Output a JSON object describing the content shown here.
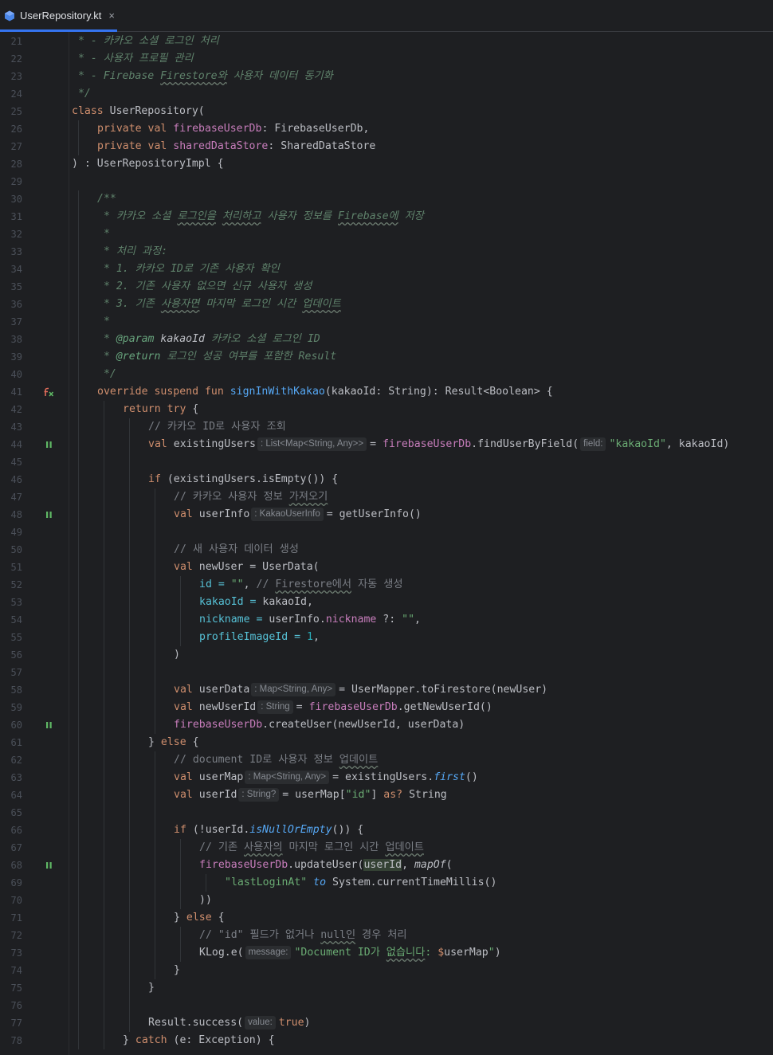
{
  "tab": {
    "filename": "UserRepository.kt",
    "close_label": "×"
  },
  "lines": [
    {
      "n": "21",
      "i": 0,
      "t": [
        [
          "doc",
          " * - 카카오 소셜 로그인 처리"
        ]
      ]
    },
    {
      "n": "22",
      "i": 0,
      "t": [
        [
          "doc",
          " * - 사용자 프로필 관리"
        ]
      ]
    },
    {
      "n": "23",
      "i": 0,
      "t": [
        [
          "doc",
          " * - Firebase "
        ],
        [
          "doc sq",
          "Firestore와"
        ],
        [
          "doc",
          " 사용자 데이터 동기화"
        ]
      ]
    },
    {
      "n": "24",
      "i": 0,
      "t": [
        [
          "doc",
          " */"
        ]
      ]
    },
    {
      "n": "25",
      "i": 0,
      "t": [
        [
          "kw",
          "class "
        ],
        [
          "",
          "UserRepository("
        ]
      ]
    },
    {
      "n": "26",
      "i": 1,
      "t": [
        [
          "kw",
          "private val "
        ],
        [
          "fld",
          "firebaseUserDb"
        ],
        [
          "",
          ": FirebaseUserDb,"
        ]
      ]
    },
    {
      "n": "27",
      "i": 1,
      "t": [
        [
          "kw",
          "private val "
        ],
        [
          "fld",
          "sharedDataStore"
        ],
        [
          "",
          ": SharedDataStore"
        ]
      ]
    },
    {
      "n": "28",
      "i": 0,
      "t": [
        [
          "",
          ") : UserRepositoryImpl {"
        ]
      ]
    },
    {
      "n": "29",
      "i": 0,
      "t": []
    },
    {
      "n": "30",
      "i": 1,
      "t": [
        [
          "doc",
          "/**"
        ]
      ]
    },
    {
      "n": "31",
      "i": 1,
      "t": [
        [
          "doc",
          " * 카카오 소셜 "
        ],
        [
          "doc sq",
          "로그인을"
        ],
        [
          "doc",
          " "
        ],
        [
          "doc sq",
          "처리하고"
        ],
        [
          "doc",
          " 사용자 정보를 "
        ],
        [
          "doc sq",
          "Firebase에"
        ],
        [
          "doc",
          " 저장"
        ]
      ]
    },
    {
      "n": "32",
      "i": 1,
      "t": [
        [
          "doc",
          " *"
        ]
      ]
    },
    {
      "n": "33",
      "i": 1,
      "t": [
        [
          "doc",
          " * 처리 과정:"
        ]
      ]
    },
    {
      "n": "34",
      "i": 1,
      "t": [
        [
          "doc",
          " * 1. 카카오 ID로 기존 사용자 확인"
        ]
      ]
    },
    {
      "n": "35",
      "i": 1,
      "t": [
        [
          "doc",
          " * 2. 기존 사용자 없으면 신규 사용자 생성"
        ]
      ]
    },
    {
      "n": "36",
      "i": 1,
      "t": [
        [
          "doc",
          " * 3. 기존 "
        ],
        [
          "doc sq",
          "사용자면"
        ],
        [
          "doc",
          " 마지막 로그인 시간 "
        ],
        [
          "doc sq",
          "업데이트"
        ]
      ]
    },
    {
      "n": "37",
      "i": 1,
      "t": [
        [
          "doc",
          " *"
        ]
      ]
    },
    {
      "n": "38",
      "i": 1,
      "t": [
        [
          "doc",
          " * "
        ],
        [
          "tag",
          "@param"
        ],
        [
          "it",
          " kakaoId"
        ],
        [
          "doc",
          " 카카오 소셜 로그인 ID"
        ]
      ]
    },
    {
      "n": "39",
      "i": 1,
      "t": [
        [
          "doc",
          " * "
        ],
        [
          "tag",
          "@return"
        ],
        [
          "doc",
          " 로그인 성공 여부를 포함한 Result"
        ]
      ]
    },
    {
      "n": "40",
      "i": 1,
      "t": [
        [
          "doc",
          " */"
        ]
      ]
    },
    {
      "n": "41",
      "i": 1,
      "g": "fx",
      "t": [
        [
          "kw",
          "override suspend fun "
        ],
        [
          "fn",
          "signInWithKakao"
        ],
        [
          "",
          "(kakaoId: String): Result<Boolean> {"
        ]
      ]
    },
    {
      "n": "42",
      "i": 2,
      "t": [
        [
          "kw",
          "return try "
        ],
        [
          "",
          "{"
        ]
      ]
    },
    {
      "n": "43",
      "i": 3,
      "t": [
        [
          "cm",
          "// 카카오 ID로 사용자 조회"
        ]
      ]
    },
    {
      "n": "44",
      "i": 3,
      "g": "susp",
      "t": [
        [
          "kw",
          "val "
        ],
        [
          "",
          "existingUsers"
        ],
        [
          "hint",
          ": List<Map<String, Any>>"
        ],
        [
          "",
          "= "
        ],
        [
          "fld",
          "firebaseUserDb"
        ],
        [
          "",
          ".findUserByField("
        ],
        [
          "hint",
          "field:"
        ],
        [
          "str",
          "\"kakaoId\""
        ],
        [
          "",
          ", kakaoId)"
        ]
      ]
    },
    {
      "n": "45",
      "i": 3,
      "t": []
    },
    {
      "n": "46",
      "i": 3,
      "t": [
        [
          "kw",
          "if "
        ],
        [
          "",
          "(existingUsers.isEmpty()) {"
        ]
      ]
    },
    {
      "n": "47",
      "i": 4,
      "t": [
        [
          "cm",
          "// 카카오 사용자 정보 "
        ],
        [
          "cm sq",
          "가져오기"
        ]
      ]
    },
    {
      "n": "48",
      "i": 4,
      "g": "susp",
      "t": [
        [
          "kw",
          "val "
        ],
        [
          "",
          "userInfo"
        ],
        [
          "hint",
          ": KakaoUserInfo"
        ],
        [
          "",
          "= getUserInfo()"
        ]
      ]
    },
    {
      "n": "49",
      "i": 4,
      "t": []
    },
    {
      "n": "50",
      "i": 4,
      "t": [
        [
          "cm",
          "// 새 사용자 데이터 생성"
        ]
      ]
    },
    {
      "n": "51",
      "i": 4,
      "t": [
        [
          "kw",
          "val "
        ],
        [
          "",
          "newUser = UserData("
        ]
      ]
    },
    {
      "n": "52",
      "i": 5,
      "t": [
        [
          "par",
          "id"
        ],
        [
          "par",
          " = "
        ],
        [
          "str",
          "\"\""
        ],
        [
          "",
          ", "
        ],
        [
          "cm",
          "// "
        ],
        [
          "cm sq",
          "Firestore에서"
        ],
        [
          "cm",
          " 자동 생성"
        ]
      ]
    },
    {
      "n": "53",
      "i": 5,
      "t": [
        [
          "par",
          "kakaoId"
        ],
        [
          "par",
          " = "
        ],
        [
          "",
          "kakaoId,"
        ]
      ]
    },
    {
      "n": "54",
      "i": 5,
      "t": [
        [
          "par",
          "nickname"
        ],
        [
          "par",
          " = "
        ],
        [
          "",
          "userInfo."
        ],
        [
          "fld",
          "nickname"
        ],
        [
          "",
          " ?: "
        ],
        [
          "str",
          "\"\""
        ],
        [
          "",
          ","
        ]
      ]
    },
    {
      "n": "55",
      "i": 5,
      "t": [
        [
          "par",
          "profileImageId"
        ],
        [
          "par",
          " = "
        ],
        [
          "num",
          "1"
        ],
        [
          "",
          ","
        ]
      ]
    },
    {
      "n": "56",
      "i": 4,
      "t": [
        [
          "",
          ")"
        ]
      ]
    },
    {
      "n": "57",
      "i": 4,
      "t": []
    },
    {
      "n": "58",
      "i": 4,
      "t": [
        [
          "kw",
          "val "
        ],
        [
          "",
          "userData"
        ],
        [
          "hint",
          ": Map<String, Any>"
        ],
        [
          "",
          "= UserMapper.toFirestore(newUser)"
        ]
      ]
    },
    {
      "n": "59",
      "i": 4,
      "t": [
        [
          "kw",
          "val "
        ],
        [
          "",
          "newUserId"
        ],
        [
          "hint",
          ": String"
        ],
        [
          "",
          "= "
        ],
        [
          "fld",
          "firebaseUserDb"
        ],
        [
          "",
          ".getNewUserId()"
        ]
      ]
    },
    {
      "n": "60",
      "i": 4,
      "g": "susp",
      "t": [
        [
          "fld",
          "firebaseUserDb"
        ],
        [
          "",
          ".createUser(newUserId, userData)"
        ]
      ]
    },
    {
      "n": "61",
      "i": 3,
      "t": [
        [
          "",
          "} "
        ],
        [
          "kw",
          "else "
        ],
        [
          "",
          "{"
        ]
      ]
    },
    {
      "n": "62",
      "i": 4,
      "t": [
        [
          "cm",
          "// document ID로 사용자 정보 "
        ],
        [
          "cm sq",
          "업데이트"
        ]
      ]
    },
    {
      "n": "63",
      "i": 4,
      "t": [
        [
          "kw",
          "val "
        ],
        [
          "",
          "userMap"
        ],
        [
          "hint",
          ": Map<String, Any>"
        ],
        [
          "",
          "= existingUsers."
        ],
        [
          "ext",
          "first"
        ],
        [
          "",
          "()"
        ]
      ]
    },
    {
      "n": "64",
      "i": 4,
      "t": [
        [
          "kw",
          "val "
        ],
        [
          "",
          "userId"
        ],
        [
          "hint",
          ": String?"
        ],
        [
          "",
          "= userMap["
        ],
        [
          "str",
          "\"id\""
        ],
        [
          "",
          "] "
        ],
        [
          "kw",
          "as? "
        ],
        [
          "",
          "String"
        ]
      ]
    },
    {
      "n": "65",
      "i": 4,
      "t": []
    },
    {
      "n": "66",
      "i": 4,
      "t": [
        [
          "kw",
          "if "
        ],
        [
          "",
          "(!userId."
        ],
        [
          "ext",
          "isNullOrEmpty"
        ],
        [
          "",
          "()) {"
        ]
      ]
    },
    {
      "n": "67",
      "i": 5,
      "t": [
        [
          "cm",
          "// 기존 "
        ],
        [
          "cm sq",
          "사용자의"
        ],
        [
          "cm",
          " 마지막 로그인 시간 "
        ],
        [
          "cm sq",
          "업데이트"
        ]
      ]
    },
    {
      "n": "68",
      "i": 5,
      "g": "susp",
      "t": [
        [
          "fld",
          "firebaseUserDb"
        ],
        [
          "",
          ".updateUser("
        ],
        [
          "hl",
          "userId"
        ],
        [
          "",
          ", "
        ],
        [
          "it",
          "mapOf"
        ],
        [
          "",
          "("
        ]
      ]
    },
    {
      "n": "69",
      "i": 6,
      "t": [
        [
          "str",
          "\"lastLoginAt\""
        ],
        [
          "",
          " "
        ],
        [
          "ext",
          "to"
        ],
        [
          "",
          " System.currentTimeMillis()"
        ]
      ]
    },
    {
      "n": "70",
      "i": 5,
      "t": [
        [
          "",
          "))"
        ]
      ]
    },
    {
      "n": "71",
      "i": 4,
      "t": [
        [
          "",
          "} "
        ],
        [
          "kw",
          "else "
        ],
        [
          "",
          "{"
        ]
      ]
    },
    {
      "n": "72",
      "i": 5,
      "t": [
        [
          "cm",
          "// \"id\" 필드가 없거나 "
        ],
        [
          "cm sq",
          "null인"
        ],
        [
          "cm",
          " 경우 처리"
        ]
      ]
    },
    {
      "n": "73",
      "i": 5,
      "t": [
        [
          "",
          "KLog.e("
        ],
        [
          "hint",
          "message:"
        ],
        [
          "str",
          "\"Document ID가 "
        ],
        [
          "str sq",
          "없습니다"
        ],
        [
          "str",
          ": "
        ],
        [
          "kw",
          "$"
        ],
        [
          "",
          "userMap"
        ],
        [
          "str",
          "\""
        ],
        [
          "",
          ")"
        ]
      ]
    },
    {
      "n": "74",
      "i": 4,
      "t": [
        [
          "",
          "}"
        ]
      ]
    },
    {
      "n": "75",
      "i": 3,
      "t": [
        [
          "",
          "}"
        ]
      ]
    },
    {
      "n": "76",
      "i": 3,
      "t": []
    },
    {
      "n": "77",
      "i": 3,
      "t": [
        [
          "",
          "Result.success("
        ],
        [
          "hint",
          "value:"
        ],
        [
          "kw",
          "true"
        ],
        [
          "",
          ")"
        ]
      ]
    },
    {
      "n": "78",
      "i": 2,
      "t": [
        [
          "",
          "} "
        ],
        [
          "kw",
          "catch "
        ],
        [
          "",
          "(e: Exception) {"
        ]
      ]
    }
  ],
  "colors": {
    "background": "#1e1f22",
    "accent": "#3574f0",
    "keyword": "#cf8e6d",
    "string": "#6aab73",
    "property": "#c77dbb",
    "function": "#56a8f5"
  }
}
